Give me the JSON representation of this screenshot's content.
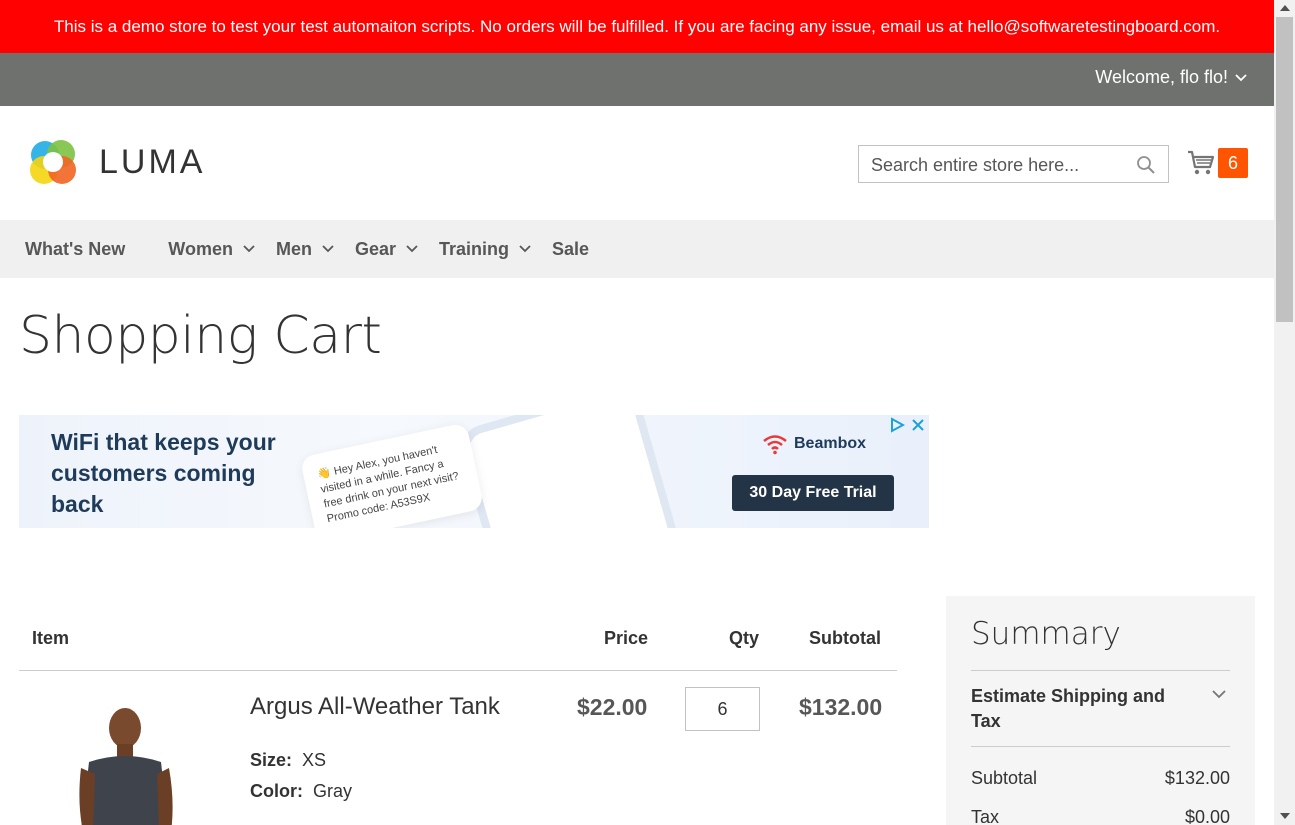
{
  "demo_banner": "This is a demo store to test your test automaiton scripts. No orders will be fulfilled. If you are facing any issue, email us at hello@softwaretestingboard.com.",
  "header": {
    "welcome": "Welcome, flo flo!",
    "logo_text": "LUMA",
    "search_placeholder": "Search entire store here...",
    "cart_count": "6"
  },
  "nav": {
    "items": [
      {
        "label": "What's New",
        "icon": "none"
      },
      {
        "label": "Women",
        "icon": "chevron-down-icon"
      },
      {
        "label": "Men",
        "icon": "chevron-down-icon"
      },
      {
        "label": "Gear",
        "icon": "chevron-down-icon"
      },
      {
        "label": "Training",
        "icon": "chevron-down-icon"
      },
      {
        "label": "Sale",
        "icon": "none"
      }
    ]
  },
  "page_title": "Shopping Cart",
  "ad": {
    "headline": "WiFi that keeps your customers coming back",
    "bubble_text": "👋 Hey Alex, you haven't visited in a while. Fancy a free drink on your next visit? Promo code: A53S9X",
    "brand": "Beambox",
    "cta": "30 Day Free Trial"
  },
  "cart": {
    "columns": {
      "item": "Item",
      "price": "Price",
      "qty": "Qty",
      "subtotal": "Subtotal"
    },
    "items": [
      {
        "name": "Argus All-Weather Tank",
        "price": "$22.00",
        "qty": "6",
        "subtotal": "$132.00",
        "options": [
          {
            "label": "Size:",
            "value": "XS"
          },
          {
            "label": "Color:",
            "value": "Gray"
          }
        ]
      }
    ]
  },
  "summary": {
    "title": "Summary",
    "estimate_label": "Estimate Shipping and Tax",
    "rows": [
      {
        "label": "Subtotal",
        "value": "$132.00"
      },
      {
        "label": "Tax",
        "value": "$0.00"
      }
    ]
  },
  "colors": {
    "demo_banner": "#ff0101",
    "top_bar": "#6e716e",
    "cart_badge": "#ff5501",
    "nav_bg": "#f0f0f0",
    "ad_cta": "#243447",
    "summary_bg": "#f5f5f5"
  }
}
